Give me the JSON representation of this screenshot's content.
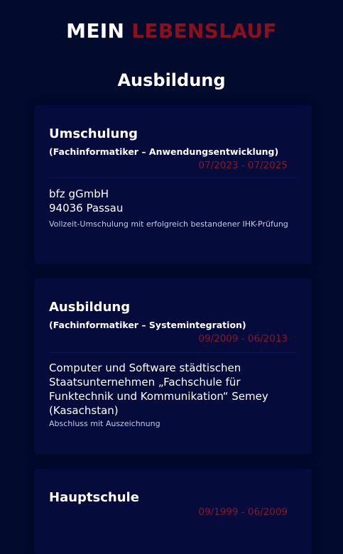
{
  "header": {
    "title_part1": "MEIN ",
    "title_part2": "LEBENSLAUF"
  },
  "section": {
    "title": "Ausbildung"
  },
  "entries": [
    {
      "title": "Umschulung",
      "subtitle": "(Fachinformatiker – Anwendungsentwicklung)",
      "date": "07/2023 - 07/2025",
      "org_line1": "bfz gGmbH",
      "org_line2": "94036 Passau",
      "note": "Vollzeit-Umschulung mit erfolgreich bestandener IHK-Prüfung"
    },
    {
      "title": "Ausbildung",
      "subtitle": "(Fachinformatiker – Systemintegration)",
      "date": "09/2009 - 06/2013",
      "org": "Computer und Software städtischen Staatsunternehmen „Fachschule für Funktechnik und Kommunikation“ Semey (Kasachstan)",
      "note": "Abschluss mit Auszeichnung"
    },
    {
      "title": "Hauptschule",
      "date": "09/1999 - 06/2009"
    }
  ],
  "colors": {
    "background": "#020a2e",
    "card": "#050b3b",
    "accent": "#8d0f1c"
  }
}
